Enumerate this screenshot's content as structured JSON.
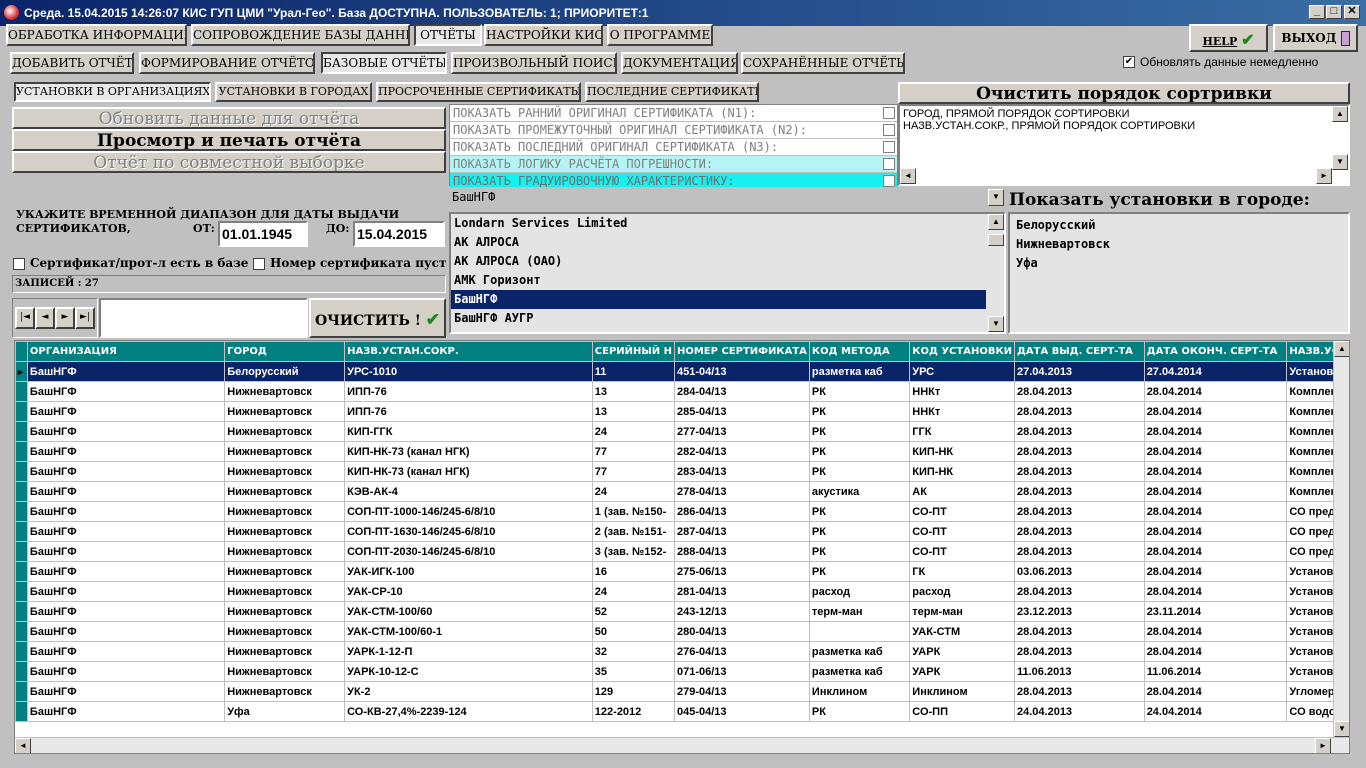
{
  "window": {
    "title": "Среда. 15.04.2015 14:26:07 КИС ГУП ЦМИ \"Урал-Гео\". База ДОСТУПНА. ПОЛЬЗОВАТЕЛЬ: 1; ПРИОРИТЕТ:1"
  },
  "main_menu": [
    "ОБРАБОТКА ИНФОРМАЦИИ",
    "СОПРОВОЖДЕНИЕ БАЗЫ ДАННЫХ",
    "ОТЧЁТЫ",
    "НАСТРОЙКИ КИС",
    "О ПРОГРАММЕ"
  ],
  "help_label": "HELP",
  "exit_label": "ВЫХОД",
  "reports_tabs": [
    "ДОБАВИТЬ ОТЧЁТ",
    "ФОРМИРОВАНИЕ ОТЧЁТОВ",
    "БАЗОВЫЕ ОТЧЁТЫ",
    "ПРОИЗВОЛЬНЫЙ ПОИСК",
    "ДОКУМЕНТАЦИЯ",
    "СОХРАНЁННЫЕ ОТЧЁТЫ"
  ],
  "update_now_label": "Обновлять данные немедленно",
  "sub_tabs": [
    "УСТАНОВКИ В ОРГАНИЗАЦИЯХ",
    "УСТАНОВКИ В ГОРОДАХ",
    "ПРОСРОЧЕННЫЕ СЕРТИФИКАТЫ",
    "ПОСЛЕДНИЕ СЕРТИФИКАТЫ"
  ],
  "clear_sort_label": "Очистить порядок сортривки",
  "sort_order": [
    "ГОРОД, ПРЯМОЙ ПОРЯДОК СОРТИРОВКИ",
    "НАЗВ.УСТАН.СОКР., ПРЯМОЙ ПОРЯДОК СОРТИРОВКИ"
  ],
  "actions": {
    "refresh": "Обновить данные для отчёта",
    "print": "Просмотр и печать отчёта",
    "joint": "Отчёт по совместной выборке"
  },
  "options": [
    "ПОКАЗАТЬ РАННИЙ ОРИГИНАЛ СЕРТИФИКАТА (N1):",
    "ПОКАЗАТЬ ПРОМЕЖУТОЧНЫЙ ОРИГИНАЛ СЕРТИФИКАТА (N2):",
    "ПОКАЗАТЬ ПОСЛЕДНИЙ ОРИГИНАЛ СЕРТИФИКАТА (N3):",
    "ПОКАЗАТЬ ЛОГИКУ РАСЧЁТА ПОГРЕШНОСТИ:",
    "ПОКАЗАТЬ ГРАДУИРОВОЧНУЮ ХАРАКТЕРИСТИКУ:"
  ],
  "org_combo_value": "БашНГФ",
  "org_list": [
    "Londarn Services Limited",
    "АК АЛРОСА",
    "АК АЛРОСА (ОАО)",
    "АМК Горизонт",
    "БашНГФ",
    "БашНГФ АУГР"
  ],
  "org_selected_index": 4,
  "city_panel_title": "Показать установки в городе:",
  "cities": [
    "Белорусский",
    "Нижневартовск",
    "Уфа"
  ],
  "date_range": {
    "prompt_line1": "УКАЖИТЕ ВРЕМЕННОЙ ДИАПАЗОН ДЛЯ ДАТЫ ВЫДАЧИ",
    "prompt_line2": "СЕРТИФИКАТОВ,",
    "from_label": "ОТ:",
    "from_value": "01.01.1945",
    "to_label": "ДО:",
    "to_value": "15.04.2015"
  },
  "filters": {
    "cert_exists": "Сертификат/прот-л есть в базе",
    "cert_number_empty": "Номер сертификата пуст"
  },
  "records_label": "ЗАПИСЕЙ : 27",
  "nav_buttons": [
    "|◄",
    "◄",
    "►",
    "►|"
  ],
  "clear_label": "ОЧИСТИТЬ !",
  "grid": {
    "columns": [
      "ОРГАНИЗАЦИЯ",
      "ГОРОД",
      "НАЗВ.УСТАН.СОКР.",
      "СЕРИЙНЫЙ Н",
      "НОМЕР СЕРТИФИКАТА",
      "КОД МЕТОДА",
      "КОД УСТАНОВКИ",
      "ДАТА ВЫД. СЕРТ-ТА",
      "ДАТА ОКОНЧ. СЕРТ-ТА",
      "НАЗВ.УСТ"
    ],
    "selected_row": 0,
    "rows": [
      [
        "БашНГФ",
        "Белорусский",
        "УРС-1010",
        "11",
        "451-04/13",
        "разметка каб",
        "УРС",
        "27.04.2013",
        "27.04.2014",
        "Установка"
      ],
      [
        "БашНГФ",
        "Нижневартовск",
        "ИПП-76",
        "13",
        "284-04/13",
        "РК",
        "ННКт",
        "28.04.2013",
        "28.04.2014",
        "Комплект"
      ],
      [
        "БашНГФ",
        "Нижневартовск",
        "ИПП-76",
        "13",
        "285-04/13",
        "РК",
        "ННКт",
        "28.04.2013",
        "28.04.2014",
        "Комплект"
      ],
      [
        "БашНГФ",
        "Нижневартовск",
        "КИП-ГГК",
        "24",
        "277-04/13",
        "РК",
        "ГГК",
        "28.04.2013",
        "28.04.2014",
        "Комплект"
      ],
      [
        "БашНГФ",
        "Нижневартовск",
        "КИП-НК-73 (канал НГК)",
        "77",
        "282-04/13",
        "РК",
        "КИП-НК",
        "28.04.2013",
        "28.04.2014",
        "Комплект"
      ],
      [
        "БашНГФ",
        "Нижневартовск",
        "КИП-НК-73 (канал НГК)",
        "77",
        "283-04/13",
        "РК",
        "КИП-НК",
        "28.04.2013",
        "28.04.2014",
        "Комплект"
      ],
      [
        "БашНГФ",
        "Нижневартовск",
        "КЭВ-АК-4",
        "24",
        "278-04/13",
        "акустика",
        "АК",
        "28.04.2013",
        "28.04.2014",
        "Комплект"
      ],
      [
        "БашНГФ",
        "Нижневартовск",
        "СОП-ПТ-1000-146/245-6/8/10",
        "1 (зав. №150-",
        "286-04/13",
        "РК",
        "СО-ПТ",
        "28.04.2013",
        "28.04.2014",
        "СО предп"
      ],
      [
        "БашНГФ",
        "Нижневартовск",
        "СОП-ПТ-1630-146/245-6/8/10",
        "2 (зав. №151-",
        "287-04/13",
        "РК",
        "СО-ПТ",
        "28.04.2013",
        "28.04.2014",
        "СО предп"
      ],
      [
        "БашНГФ",
        "Нижневартовск",
        "СОП-ПТ-2030-146/245-6/8/10",
        "3 (зав. №152-",
        "288-04/13",
        "РК",
        "СО-ПТ",
        "28.04.2013",
        "28.04.2014",
        "СО предп"
      ],
      [
        "БашНГФ",
        "Нижневартовск",
        "УАК-ИГК-100",
        "16",
        "275-06/13",
        "РК",
        "ГК",
        "03.06.2013",
        "28.04.2014",
        "Установка"
      ],
      [
        "БашНГФ",
        "Нижневартовск",
        "УАК-СР-10",
        "24",
        "281-04/13",
        "расход",
        "расход",
        "28.04.2013",
        "28.04.2014",
        "Установка"
      ],
      [
        "БашНГФ",
        "Нижневартовск",
        "УАК-СТМ-100/60",
        "52",
        "243-12/13",
        "терм-ман",
        "терм-ман",
        "23.12.2013",
        "23.11.2014",
        "Установка"
      ],
      [
        "БашНГФ",
        "Нижневартовск",
        "УАК-СТМ-100/60-1",
        "50",
        "280-04/13",
        "",
        "УАК-СТМ",
        "28.04.2013",
        "28.04.2014",
        "Установка"
      ],
      [
        "БашНГФ",
        "Нижневартовск",
        "УАРК-1-12-П",
        "32",
        "276-04/13",
        "разметка каб",
        "УАРК",
        "28.04.2013",
        "28.04.2014",
        "Установка"
      ],
      [
        "БашНГФ",
        "Нижневартовск",
        "УАРК-10-12-С",
        "35",
        "071-06/13",
        "разметка каб",
        "УАРК",
        "11.06.2013",
        "11.06.2014",
        "Установка"
      ],
      [
        "БашНГФ",
        "Нижневартовск",
        "УК-2",
        "129",
        "279-04/13",
        "Инклином",
        "Инклином",
        "28.04.2013",
        "28.04.2014",
        "Угломер-и"
      ],
      [
        "БашНГФ",
        "Уфа",
        "СО-КВ-27,4%-2239-124",
        "122-2012",
        "045-04/13",
        "РК",
        "СО-ПП",
        "24.04.2013",
        "24.04.2014",
        "СО водон"
      ]
    ]
  }
}
